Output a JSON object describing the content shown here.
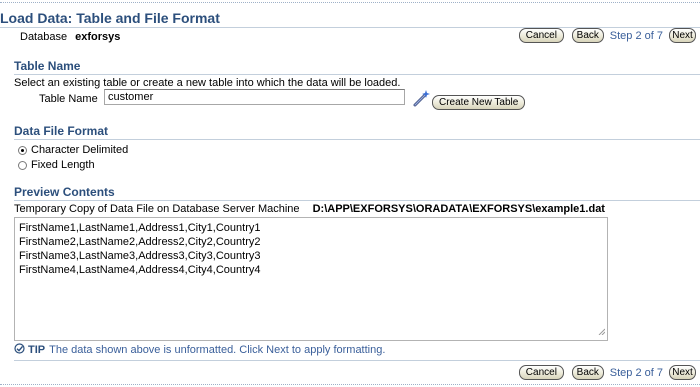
{
  "header": {
    "title": "Load Data: Table and File Format",
    "database_label": "Database",
    "database_value": "exforsys"
  },
  "nav": {
    "cancel_label": "Cancel",
    "back_label": "Back",
    "step_text": "Step 2 of 7",
    "next_label": "Next"
  },
  "table_name_section": {
    "heading": "Table Name",
    "instructions": "Select an existing table or create a new table into which the data will be loaded.",
    "field_label": "Table Name",
    "field_value": "customer",
    "create_button_label": "Create New Table"
  },
  "data_file_format": {
    "heading": "Data File Format",
    "options": [
      "Character Delimited",
      "Fixed Length"
    ],
    "selected": "Character Delimited"
  },
  "preview_contents": {
    "heading": "Preview Contents",
    "file_label": "Temporary Copy of Data File on Database Server Machine",
    "file_path": "D:\\APP\\EXFORSYS\\ORADATA\\EXFORSYS\\example1.dat",
    "lines": [
      "FirstName1,LastName1,Address1,City1,Country1",
      "FirstName2,LastName2,Address2,City2,Country2",
      "FirstName3,LastName3,Address3,City3,Country3",
      "FirstName4,LastName4,Address4,City4,Country4"
    ]
  },
  "tip": {
    "label": "TIP",
    "text": "The data shown above is unformatted. Click Next to apply formatting."
  },
  "icons": {
    "wand": "magic-wand-icon",
    "tip": "checkmark-circle-icon",
    "grip": "resize-grip-icon"
  }
}
